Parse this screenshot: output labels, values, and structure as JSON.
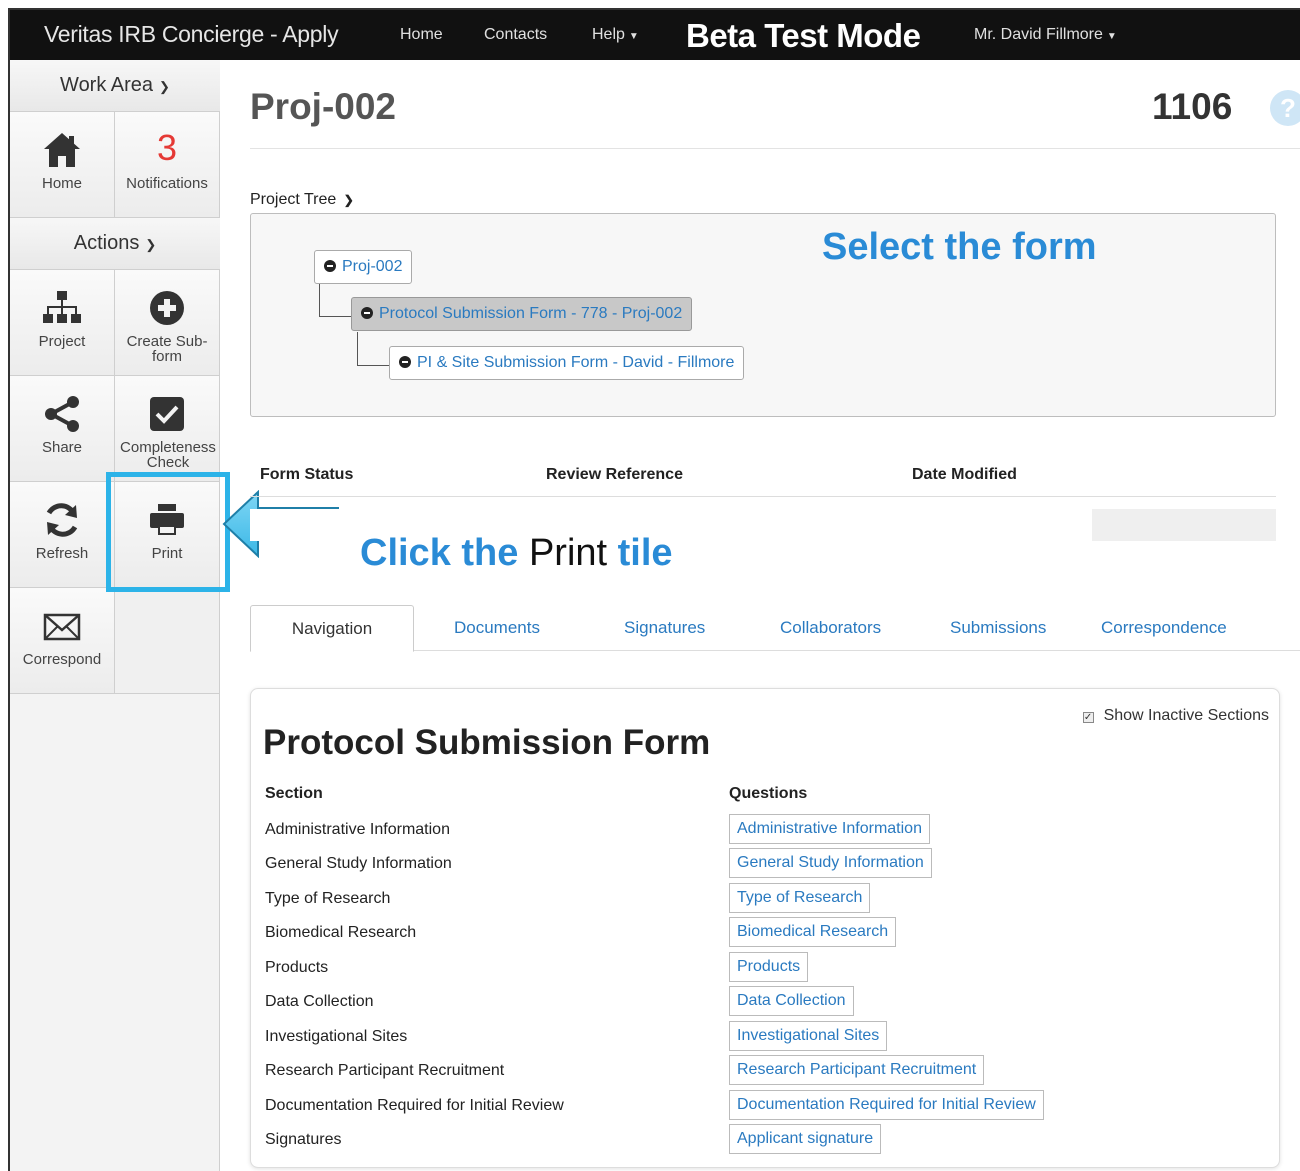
{
  "navbar": {
    "brand": "Veritas IRB Concierge - Apply",
    "home": "Home",
    "contacts": "Contacts",
    "help": "Help",
    "beta": "Beta Test Mode",
    "user": "Mr. David Fillmore"
  },
  "sidebar": {
    "work_area": "Work Area",
    "home_label": "Home",
    "notifications_count": "3",
    "notifications_label": "Notifications",
    "actions": "Actions",
    "project_label": "Project",
    "create_subform_label_1": "Create Sub-",
    "create_subform_label_2": "form",
    "share_label": "Share",
    "completeness_label_1": "Completeness",
    "completeness_label_2": "Check",
    "refresh_label": "Refresh",
    "print_label": "Print",
    "correspond_label": "Correspond"
  },
  "main": {
    "title": "Proj-002",
    "project_number": "1106",
    "help_glyph": "?",
    "tree_label": "Project Tree",
    "tree": {
      "root": "Proj-002",
      "child": "Protocol Submission Form - 778 - Proj-002",
      "grandchild": "PI & Site Submission Form - David - Fillmore"
    },
    "status_headers": {
      "form_status": "Form Status",
      "review_reference": "Review Reference",
      "date_modified": "Date Modified"
    },
    "tabs": [
      "Navigation",
      "Documents",
      "Signatures",
      "Collaborators",
      "Submissions",
      "Correspondence"
    ],
    "form": {
      "show_inactive": "Show Inactive Sections",
      "title": "Protocol Submission Form",
      "section_header": "Section",
      "questions_header": "Questions",
      "rows": [
        {
          "section": "Administrative Information",
          "question": "Administrative Information"
        },
        {
          "section": "General Study Information",
          "question": "General Study Information"
        },
        {
          "section": "Type of Research",
          "question": "Type of Research"
        },
        {
          "section": "Biomedical Research",
          "question": "Biomedical Research"
        },
        {
          "section": "Products",
          "question": "Products"
        },
        {
          "section": "Data Collection",
          "question": "Data Collection"
        },
        {
          "section": "Investigational Sites",
          "question": "Investigational Sites"
        },
        {
          "section": "Research Participant Recruitment",
          "question": "Research Participant Recruitment"
        },
        {
          "section": "Documentation Required for Initial Review",
          "question": "Documentation Required for Initial Review"
        },
        {
          "section": "Signatures",
          "question": "Applicant signature"
        }
      ]
    }
  },
  "callouts": {
    "select_form": "Select the form",
    "click_prefix": "Click the",
    "click_target": "Print",
    "click_suffix": "tile"
  },
  "colors": {
    "accent_blue": "#2a8bd6",
    "highlight_cyan": "#2cb3e8",
    "notification_red": "#e53935",
    "link_blue": "#2a7ac0"
  }
}
